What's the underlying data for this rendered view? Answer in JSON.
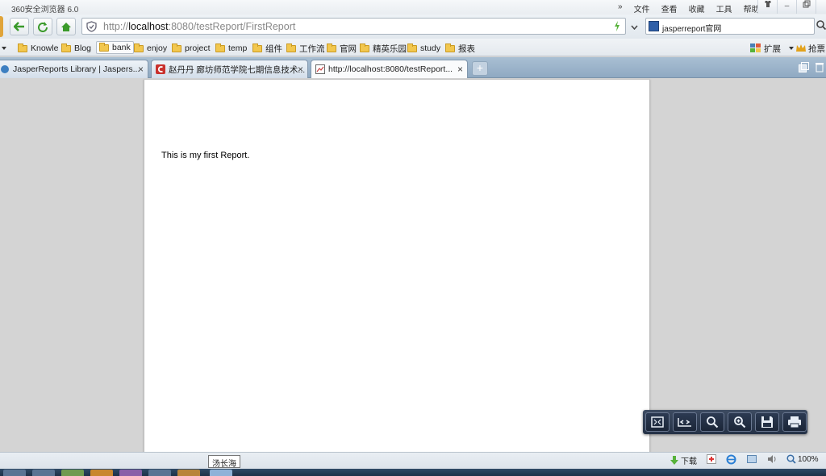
{
  "window": {
    "title": "360安全浏览器 6.0",
    "menu": [
      "文件",
      "查看",
      "收藏",
      "工具",
      "帮助"
    ],
    "menu_more": "»"
  },
  "nav": {
    "url_prefix": "http://",
    "url_host": "localhost",
    "url_rest": ":8080/testReport/FirstReport",
    "search_text": "jasperreport官网"
  },
  "bookmarks": {
    "items": [
      "Knowle",
      "Blog",
      "bank",
      "enjoy",
      "project",
      "temp",
      "组件",
      "工作流",
      "官网",
      "精英乐园",
      "study",
      "报表"
    ],
    "extend_label": "扩展",
    "grab_label": "抢票"
  },
  "tabs": [
    {
      "label": "JasperReports Library | Jaspers...",
      "close": "×"
    },
    {
      "label": "赵丹丹 廊坊师范学院七期信息技术...",
      "close": "×"
    },
    {
      "label": "http://localhost:8080/testReport...",
      "close": "×"
    }
  ],
  "newtab_label": "+",
  "report": {
    "text": "This is my first Report."
  },
  "status": {
    "tooltip": "汤长海",
    "download_label": "下载",
    "zoom": "100%"
  },
  "colors": {
    "accent": "#4a7fb5",
    "go_icon": "#57b23a"
  }
}
